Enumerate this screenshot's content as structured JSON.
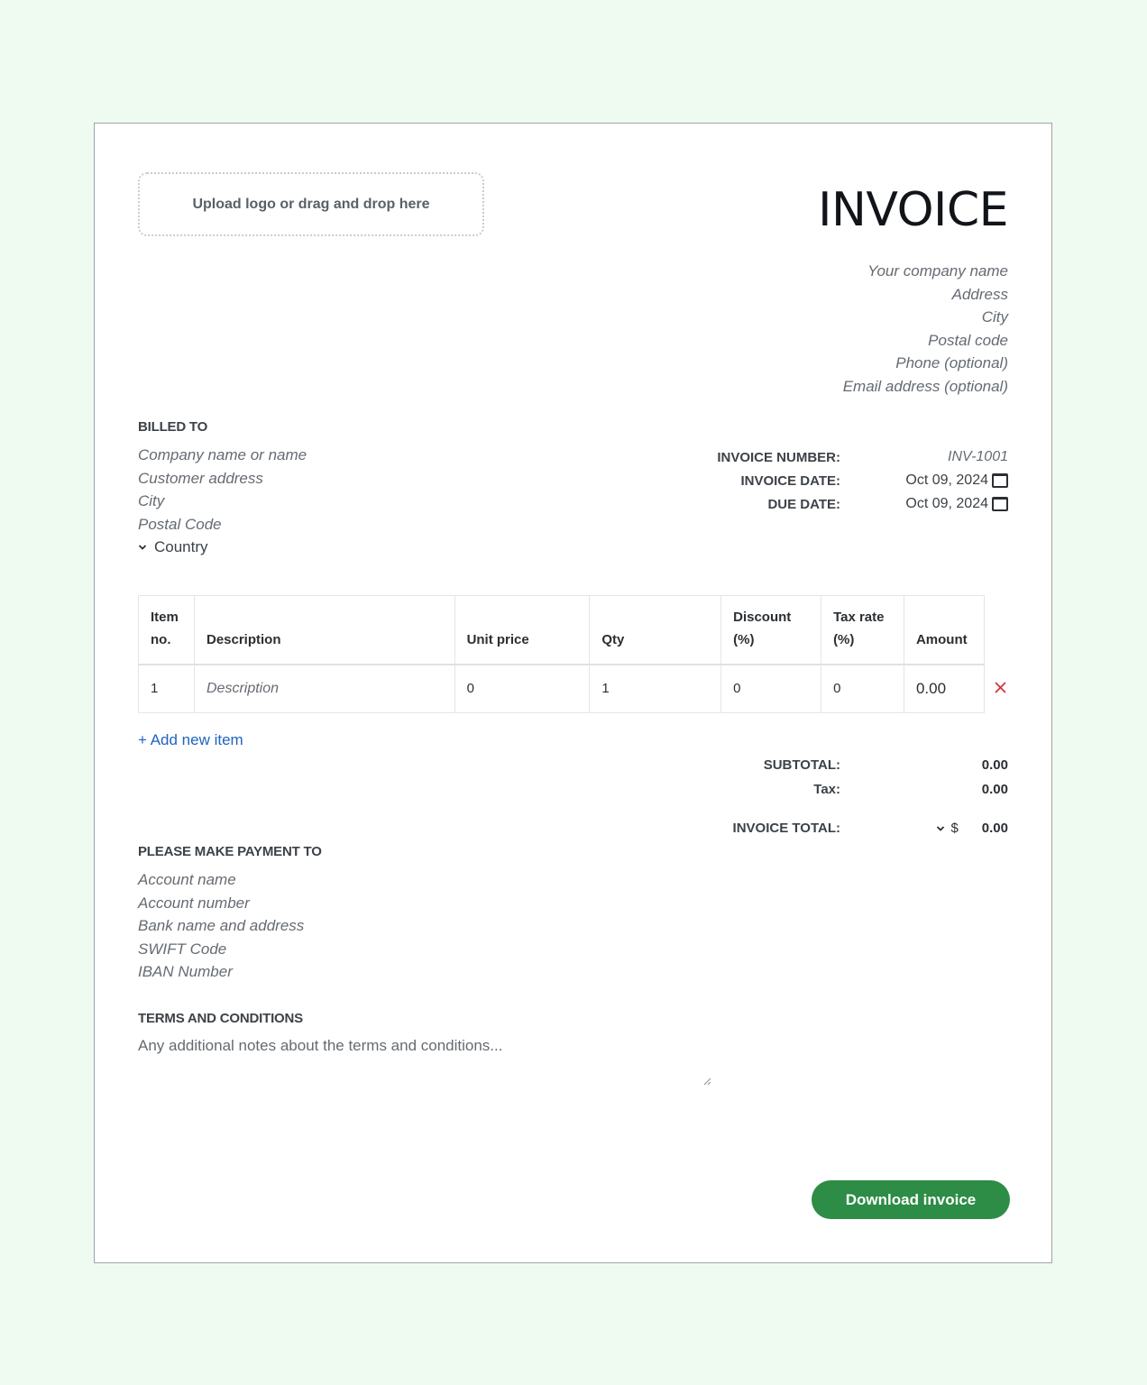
{
  "upload": {
    "label": "Upload logo or drag and drop here"
  },
  "title": "INVOICE",
  "company": [
    "Your company name",
    "Address",
    "City",
    "Postal code",
    "Phone (optional)",
    "Email address (optional)"
  ],
  "billed_to": {
    "heading": "BILLED TO",
    "lines": [
      "Company name or name",
      "Customer address",
      "City",
      "Postal Code"
    ],
    "country": "Country"
  },
  "meta": {
    "invoice_number_label": "INVOICE NUMBER:",
    "invoice_number": "INV-1001",
    "invoice_date_label": "INVOICE DATE:",
    "invoice_date": "Oct 09, 2024",
    "due_date_label": "DUE DATE:",
    "due_date": "Oct 09, 2024"
  },
  "table": {
    "headers": [
      "Item no.",
      "Description",
      "Unit price",
      "Qty",
      "Discount (%)",
      "Tax rate (%)",
      "Amount"
    ],
    "headers_l1": [
      "Item",
      "",
      "",
      "",
      "Discount",
      "Tax rate",
      ""
    ],
    "headers_l2": [
      "no.",
      "Description",
      "Unit price",
      "Qty",
      "(%)",
      "(%)",
      "Amount"
    ],
    "rows": [
      {
        "item_no": "1",
        "description": "Description",
        "unit_price": "0",
        "qty": "1",
        "discount": "0",
        "tax_rate": "0",
        "amount": "0.00"
      }
    ]
  },
  "add_item": "+ Add new item",
  "totals": {
    "subtotal_label": "SUBTOTAL:",
    "subtotal": "0.00",
    "tax_label": "Tax:",
    "tax": "0.00",
    "total_label": "INVOICE TOTAL:",
    "currency": "$",
    "total": "0.00"
  },
  "payment": {
    "heading": "PLEASE MAKE PAYMENT TO",
    "lines": [
      "Account name",
      "Account number",
      "Bank name and address",
      "SWIFT Code",
      "IBAN Number"
    ]
  },
  "terms": {
    "heading": "TERMS AND CONDITIONS",
    "placeholder": "Any additional notes about the terms and conditions..."
  },
  "download_label": "Download invoice",
  "colors": {
    "accent": "#2d8c45",
    "link": "#1f63c2",
    "remove": "#d9343d",
    "page_bg": "#effbf1"
  }
}
